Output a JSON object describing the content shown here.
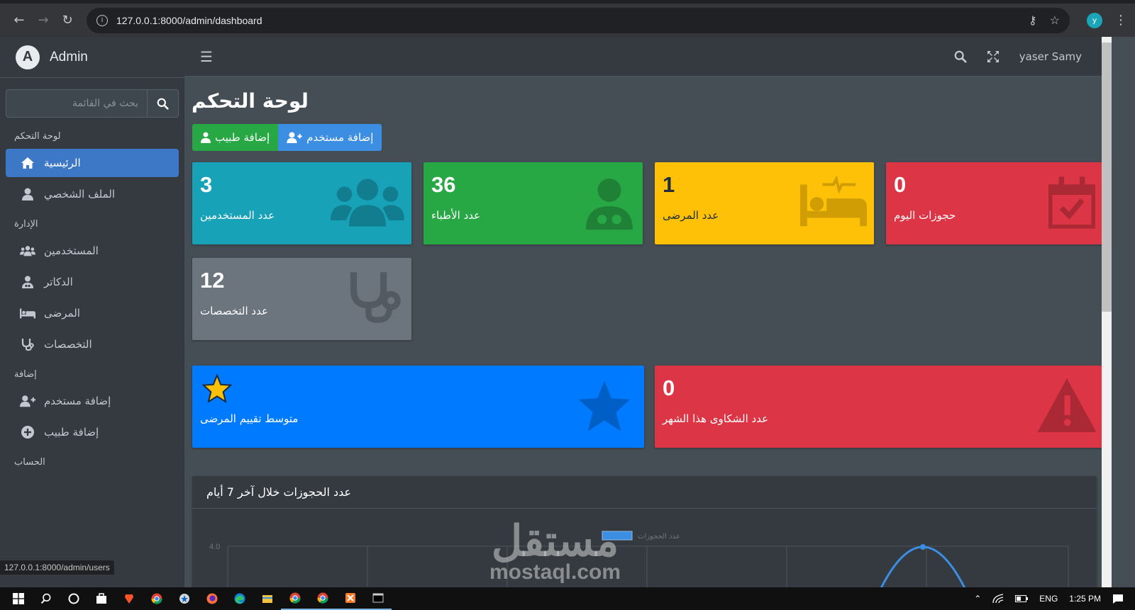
{
  "browser": {
    "url": "127.0.0.1:8000/admin/dashboard",
    "profile_initial": "y"
  },
  "sidebar": {
    "brand_logo_letter": "A",
    "brand": "Admin",
    "search_placeholder": "بحث في القائمة",
    "sections": {
      "dashboard": "لوحة التحكم",
      "management": "الإدارة",
      "add": "إضافة",
      "account": "الحساب"
    },
    "items": [
      {
        "label": "الرئيسية",
        "icon": "home-icon",
        "active": true
      },
      {
        "label": "الملف الشخصي",
        "icon": "user-icon"
      },
      {
        "label": "المستخدمين",
        "icon": "users-icon"
      },
      {
        "label": "الدكاتر",
        "icon": "doctor-icon"
      },
      {
        "label": "المرضى",
        "icon": "bed-icon"
      },
      {
        "label": "التخصصات",
        "icon": "stethoscope-icon"
      },
      {
        "label": "إضافة مستخدم",
        "icon": "user-plus-icon"
      },
      {
        "label": "إضافة طبيب",
        "icon": "plus-circle-icon"
      }
    ]
  },
  "navbar": {
    "username": "yaser Samy"
  },
  "main": {
    "title": "لوحة التحكم",
    "add_doctor": "إضافة طبيب",
    "add_user": "إضافة مستخدم"
  },
  "stats": {
    "users": {
      "value": "3",
      "label": "عدد المستخدمين",
      "color": "#17a2b8"
    },
    "doctors": {
      "value": "36",
      "label": "عدد الأطباء",
      "color": "#28a745"
    },
    "patients": {
      "value": "1",
      "label": "عدد المرضى",
      "color": "#ffc107"
    },
    "today_bookings": {
      "value": "0",
      "label": "حجوزات اليوم",
      "color": "#dc3545"
    },
    "specialties": {
      "value": "12",
      "label": "عدد التخصصات",
      "color": "#6c757d"
    },
    "rating": {
      "label": "متوسط تقييم المرضى",
      "color": "#007bff"
    },
    "complaints": {
      "value": "0",
      "label": "عدد الشكاوى هذا الشهر",
      "color": "#dc3545"
    }
  },
  "chart": {
    "title": "عدد الحجوزات خلال آخر 7 أيام",
    "legend": "عدد الحجوزات",
    "y_tick": "4.0"
  },
  "chart_data": {
    "type": "line",
    "title": "عدد الحجوزات خلال آخر 7 أيام",
    "series": [
      {
        "name": "عدد الحجوزات",
        "values": []
      }
    ],
    "ylim": [
      0,
      4.0
    ],
    "grid": true,
    "legend": "top"
  },
  "watermark": {
    "ar": "مستقل",
    "en": "mostaql.com"
  },
  "status_bar_url": "127.0.0.1:8000/admin/users",
  "taskbar": {
    "lang": "ENG",
    "time": "1:25 PM"
  }
}
